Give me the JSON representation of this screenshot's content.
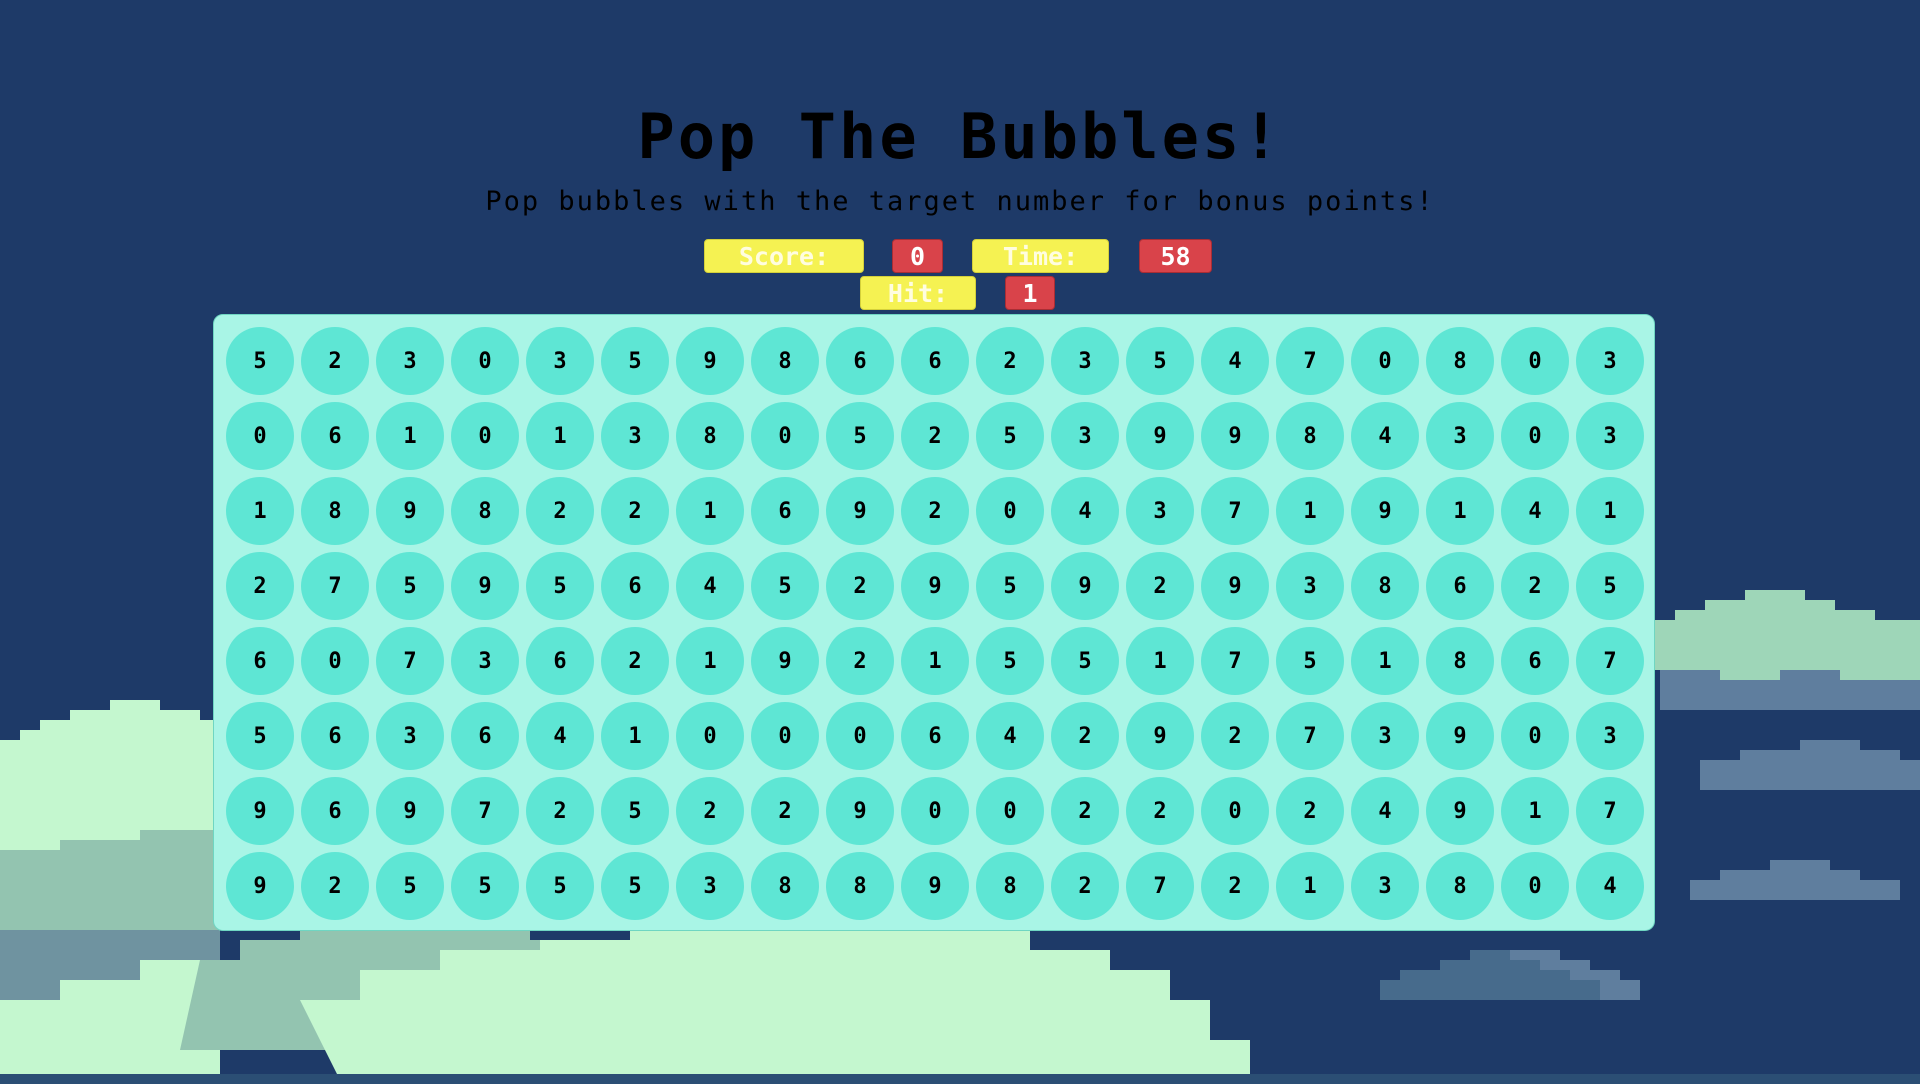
{
  "title": "Pop The Bubbles!",
  "subtitle": "Pop bubbles with the target number for bonus points!",
  "stats": {
    "score_label": "Score:",
    "score_value": "0",
    "time_label": "Time:",
    "time_value": "58",
    "hit_label": "Hit:",
    "hit_value": "1"
  },
  "colors": {
    "background": "#1e3a68",
    "board": "#a9f5e6",
    "bubble": "#5ee6d4",
    "label_pill": "#f5f252",
    "value_pill": "#d9434a"
  },
  "board": {
    "rows": [
      [
        "5",
        "2",
        "3",
        "0",
        "3",
        "5",
        "9",
        "8",
        "6",
        "6",
        "2",
        "3",
        "5",
        "4",
        "7",
        "0",
        "8",
        "0",
        "3"
      ],
      [
        "0",
        "6",
        "1",
        "0",
        "1",
        "3",
        "8",
        "0",
        "5",
        "2",
        "5",
        "3",
        "9",
        "9",
        "8",
        "4",
        "3",
        "0",
        "3"
      ],
      [
        "1",
        "8",
        "9",
        "8",
        "2",
        "2",
        "1",
        "6",
        "9",
        "2",
        "0",
        "4",
        "3",
        "7",
        "1",
        "9",
        "1",
        "4",
        "1"
      ],
      [
        "2",
        "7",
        "5",
        "9",
        "5",
        "6",
        "4",
        "5",
        "2",
        "9",
        "5",
        "9",
        "2",
        "9",
        "3",
        "8",
        "6",
        "2",
        "5"
      ],
      [
        "6",
        "0",
        "7",
        "3",
        "6",
        "2",
        "1",
        "9",
        "2",
        "1",
        "5",
        "5",
        "1",
        "7",
        "5",
        "1",
        "8",
        "6",
        "7"
      ],
      [
        "5",
        "6",
        "3",
        "6",
        "4",
        "1",
        "0",
        "0",
        "0",
        "6",
        "4",
        "2",
        "9",
        "2",
        "7",
        "3",
        "9",
        "0",
        "3"
      ],
      [
        "9",
        "6",
        "9",
        "7",
        "2",
        "5",
        "2",
        "2",
        "9",
        "0",
        "0",
        "2",
        "2",
        "0",
        "2",
        "4",
        "9",
        "1",
        "7"
      ],
      [
        "9",
        "2",
        "5",
        "5",
        "5",
        "5",
        "3",
        "8",
        "8",
        "9",
        "8",
        "2",
        "7",
        "2",
        "1",
        "3",
        "8",
        "0",
        "4"
      ]
    ]
  }
}
